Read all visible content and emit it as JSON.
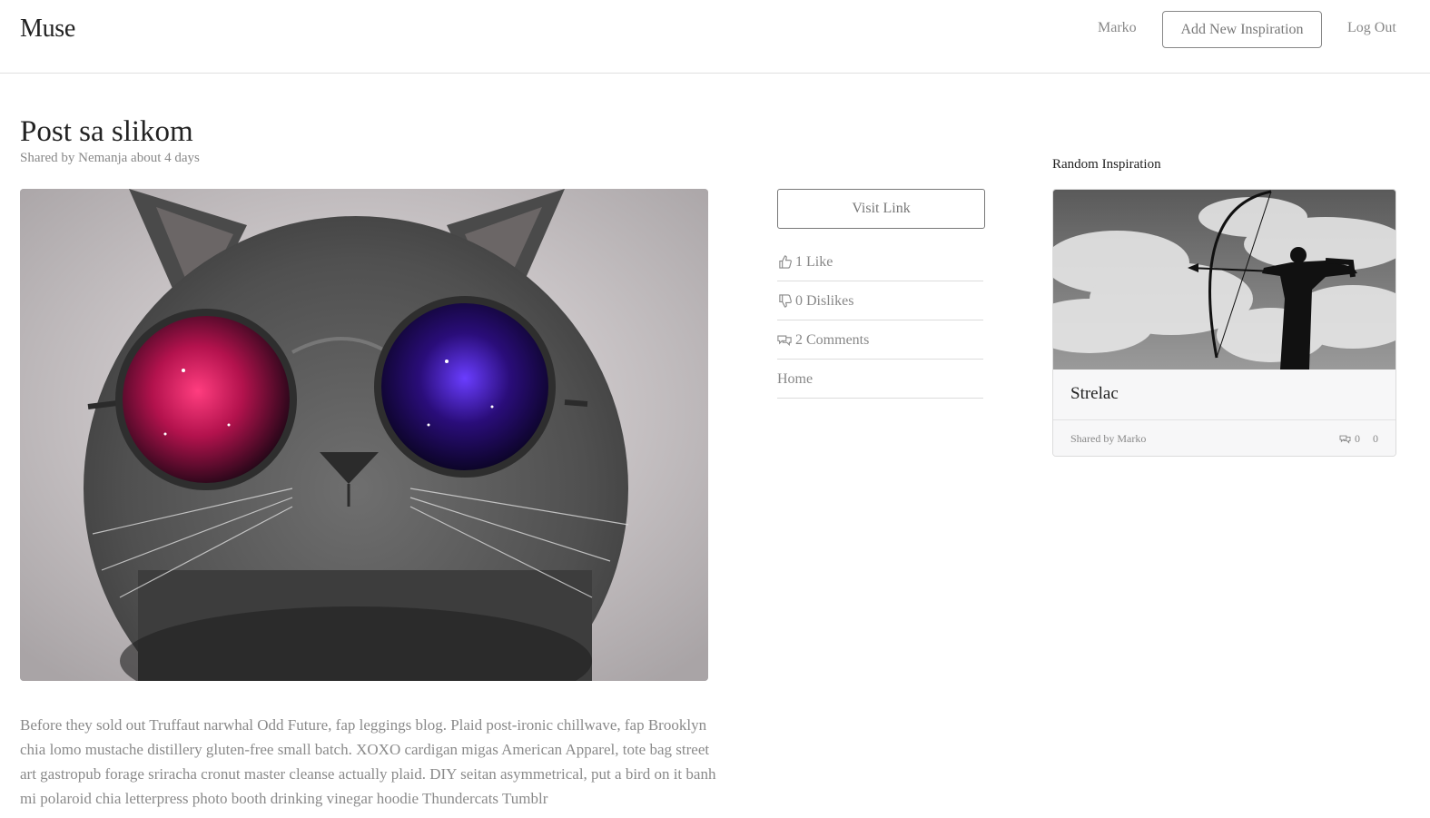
{
  "brand": "Muse",
  "nav": {
    "user": "Marko",
    "add_button": "Add New Inspiration",
    "logout": "Log Out"
  },
  "post": {
    "title": "Post sa slikom",
    "meta": "Shared by Nemanja about 4 days",
    "image_icon": "cat-with-galaxy-glasses-image",
    "body": "Before they sold out Truffaut narwhal Odd Future, fap leggings blog. Plaid post-ironic chillwave, fap Brooklyn chia lomo mustache distillery gluten-free small batch. XOXO cardigan migas American Apparel, tote bag street art gastropub forage sriracha cronut master cleanse actually plaid. DIY seitan asymmetrical, put a bird on it banh mi polaroid chia letterpress photo booth drinking vinegar hoodie Thundercats Tumblr"
  },
  "actions": {
    "visit_link": "Visit Link",
    "like": "1 Like",
    "like_icon": "thumbs-up-icon",
    "dislike": "0 Dislikes",
    "dislike_icon": "thumbs-down-icon",
    "comments": "2 Comments",
    "comments_icon": "comments-icon",
    "home": "Home"
  },
  "random": {
    "heading": "Random Inspiration",
    "card": {
      "title": "Strelac",
      "image_icon": "archer-silhouette-image",
      "shared_by": "Shared by Marko",
      "comments_count": "0",
      "other_count": "0"
    }
  },
  "colors": {
    "text_dark": "#222222",
    "text_muted": "#888888",
    "border": "#dcdcdc",
    "card_bg": "#f7f7f8"
  }
}
